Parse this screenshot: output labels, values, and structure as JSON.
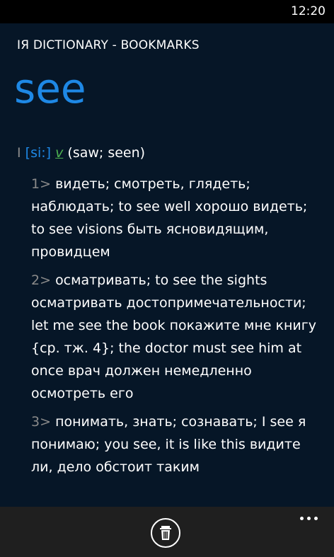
{
  "status": {
    "time": "12:20"
  },
  "app": {
    "title": "IЯ DICTIONARY - BOOKMARKS"
  },
  "entry": {
    "headword": "see",
    "roman": "I",
    "transcription": "[si:]",
    "pos": "v",
    "forms": "(saw; seen)",
    "senses": [
      {
        "num": "1>",
        "text": "видеть; смотреть, глядеть; наблюдать; to see well хорошо видеть; to see visions быть ясновидящим, провидцем"
      },
      {
        "num": "2>",
        "text": "осматривать; to see the sights осматривать достопримечательности; let me see the book покажите мне книгу {ср. тж. 4}; the doctor must see him at once врач должен немедленно осмотреть его"
      },
      {
        "num": "3>",
        "text": "понимать, знать; сознавать; I see я понимаю; you see, it is like this видите ли, дело обстоит таким"
      }
    ]
  },
  "colors": {
    "accent": "#1e88e5",
    "pos": "#4caf50",
    "background": "#061627",
    "appbar": "#1f1f1f"
  },
  "icons": {
    "delete": "trash-icon",
    "more": "ellipsis-icon"
  }
}
